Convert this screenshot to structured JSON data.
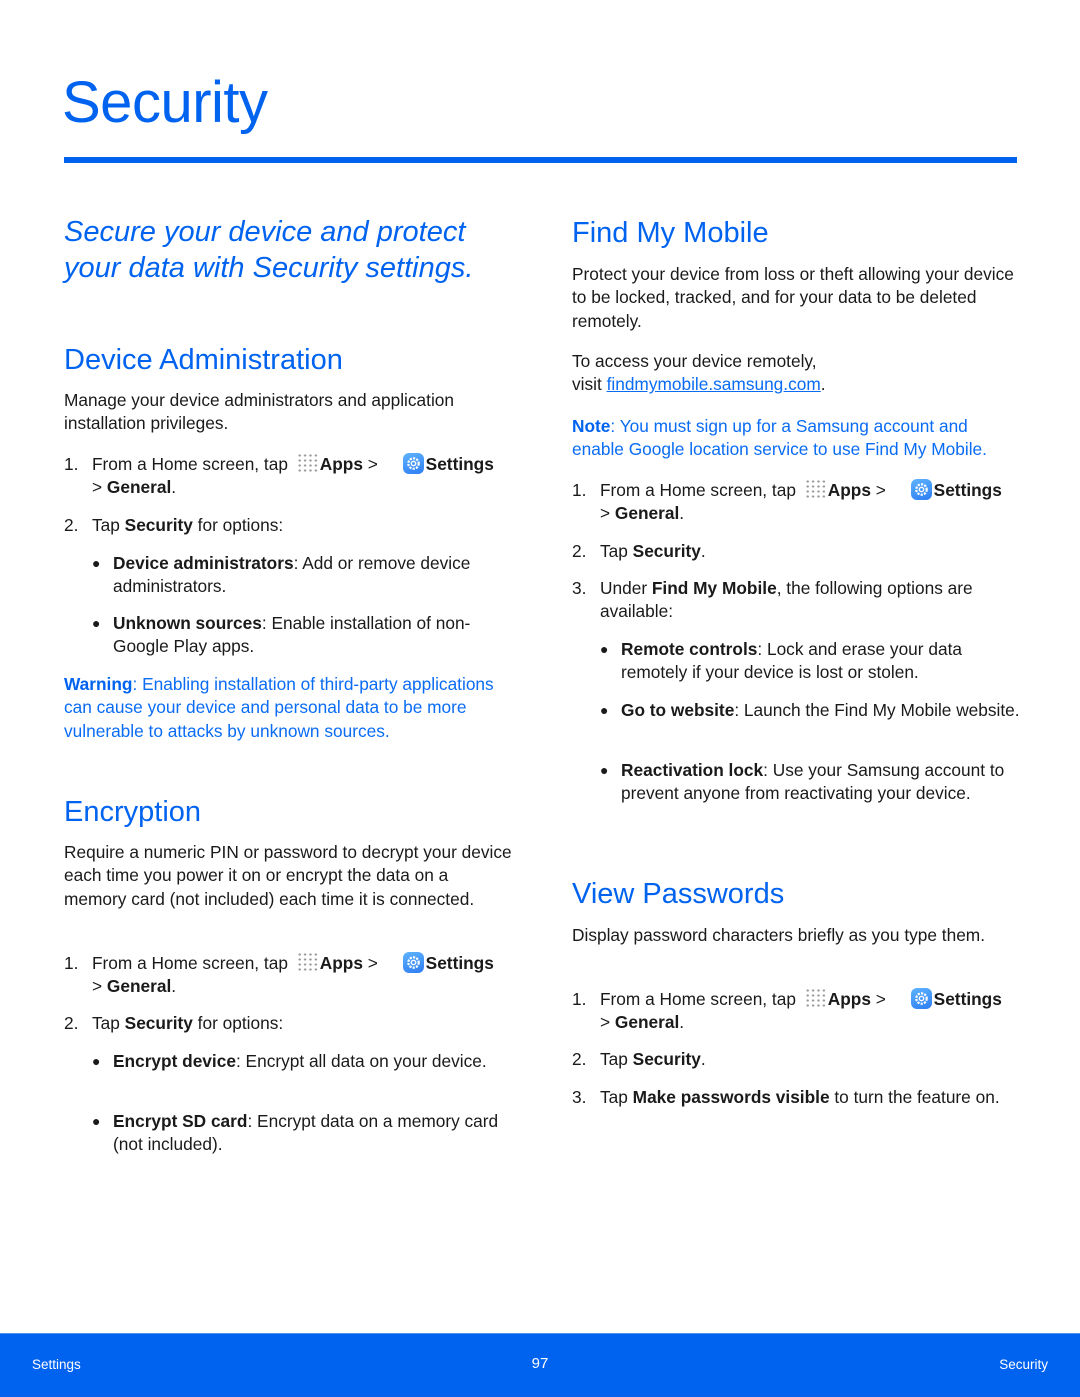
{
  "page": {
    "title": "Security",
    "intro": "Secure your device and protect your data with Security settings.",
    "accent_color": "#0063f0"
  },
  "common": {
    "step_from_home": "From a Home screen, tap",
    "apps_label": "Apps",
    "sep": ">",
    "settings_label": "Settings",
    "general_label": "General",
    "icons": {
      "apps": "apps-grid-icon",
      "settings": "settings-gear-icon"
    }
  },
  "device_admin": {
    "heading": "Device Administration",
    "description": "Manage your device administrators and application installation privileges.",
    "steps": [
      {
        "num": "1."
      },
      {
        "num": "2.",
        "pre": "Tap ",
        "bold": "Security",
        "post": " for options:"
      }
    ],
    "bullets": [
      {
        "bold": "Device administrators",
        "text": ": Add or remove device administrators."
      },
      {
        "bold": "Unknown sources",
        "text": ": Enable installation of non-Google Play apps."
      }
    ],
    "warning": {
      "label": "Warning",
      "text": ": Enabling installation of third-party applications can cause your device and personal data to be more vulnerable to attacks by unknown sources."
    }
  },
  "encryption": {
    "heading": "Encryption",
    "description": "Require a numeric PIN or password to decrypt your device each time you power it on or encrypt the data on a memory card (not included) each time it is connected.",
    "steps": [
      {
        "num": "1."
      },
      {
        "num": "2.",
        "pre": "Tap ",
        "bold": "Security",
        "post": " for options:"
      }
    ],
    "bullets": [
      {
        "bold": "Encrypt device",
        "text": ": Encrypt all data on your device."
      },
      {
        "bold": "Encrypt SD card",
        "text": ": Encrypt data on a memory card (not included)."
      }
    ]
  },
  "find_my_mobile": {
    "heading": "Find My Mobile",
    "description": "Protect your device from loss or theft allowing your device to be locked, tracked, and for your data to be deleted remotely.",
    "access_line1": "To access your device remotely,",
    "access_visit": "visit ",
    "access_link": "findmymobile.samsung.com",
    "access_end": ".",
    "note": {
      "label": "Note",
      "text": ": You must sign up for a Samsung account and enable Google location service to use Find My Mobile."
    },
    "steps": [
      {
        "num": "1."
      },
      {
        "num": "2.",
        "pre": "Tap ",
        "bold": "Security",
        "post": "."
      },
      {
        "num": "3.",
        "pre": "Under ",
        "bold": "Find My Mobile",
        "post": ", the following options are available:"
      }
    ],
    "bullets": [
      {
        "bold": "Remote controls",
        "text": ": Lock and erase your data remotely if your device is lost or stolen."
      },
      {
        "bold": "Go to website",
        "text": ": Launch the Find My Mobile website."
      },
      {
        "bold": "Reactivation lock",
        "text": ": Use your Samsung account to prevent anyone from reactivating your device."
      }
    ]
  },
  "view_passwords": {
    "heading": "View Passwords",
    "description": "Display password characters briefly as you type them.",
    "steps": [
      {
        "num": "1."
      },
      {
        "num": "2.",
        "pre": "Tap ",
        "bold": "Security",
        "post": "."
      },
      {
        "num": "3.",
        "pre": "Tap ",
        "bold": "Make passwords visible",
        "post": " to turn the feature on."
      }
    ]
  },
  "footer": {
    "left": "Settings",
    "page_number": "97",
    "right": "Security"
  }
}
